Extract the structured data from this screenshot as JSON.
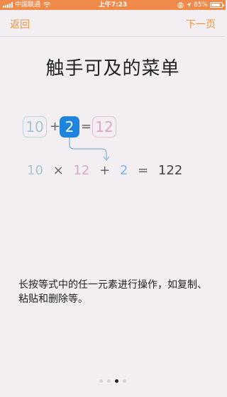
{
  "status_bar": {
    "carrier": "中国联通",
    "time": "上午7:23",
    "battery_percent": "85%",
    "battery_level": 0.85,
    "color": "#f08a4b"
  },
  "nav": {
    "back_label": "返回",
    "next_label": "下一页",
    "accent_color": "#f0923c"
  },
  "title": "触手可及的菜单",
  "equation": {
    "operand_a": "10",
    "plus": "+",
    "operand_b": "2",
    "equals": "=",
    "result_box": "12"
  },
  "expression": {
    "a": "10",
    "times": "×",
    "b": "12",
    "plus": "+",
    "c": "2",
    "equals": "=",
    "result": "122"
  },
  "description": "长按等式中的任一元素进行操作，如复制、粘贴和删除等。",
  "pager": {
    "count": 4,
    "active_index": 2
  }
}
